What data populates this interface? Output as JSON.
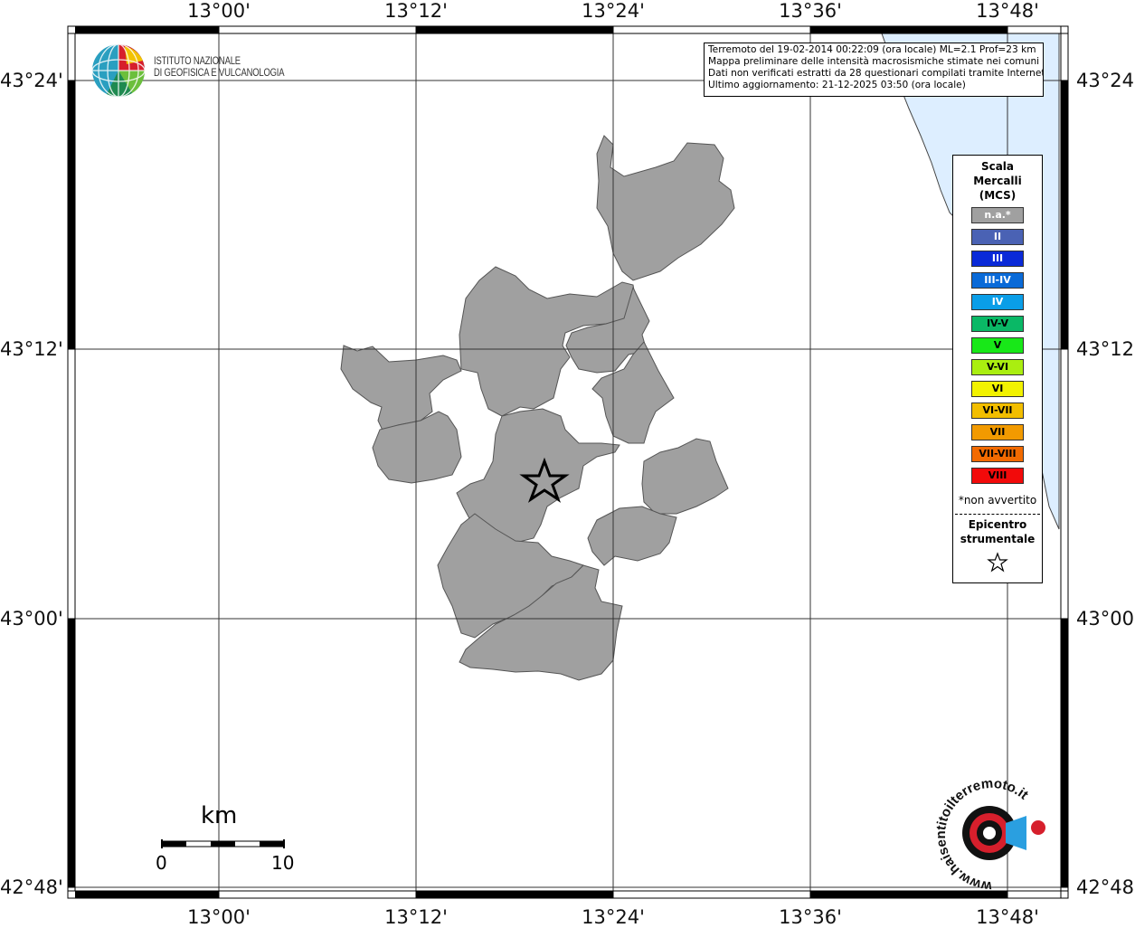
{
  "info": {
    "line1": "Terremoto del 19-02-2014 00:22:09 (ora locale) ML=2.1 Prof=23 km",
    "line2": "Mappa preliminare delle intensità macrosismiche stimate nei comuni",
    "line3": "Dati non verificati estratti da 28 questionari compilati tramite Internet.",
    "line4": "Ultimo aggiornamento: 21-12-2025 03:50 (ora locale)"
  },
  "logo": {
    "line1": "ISTITUTO NAZIONALE",
    "line2": "DI GEOFISICA E VULCANOLOGIA"
  },
  "axes": {
    "lon_ticks": [
      "13°00'",
      "13°12'",
      "13°24'",
      "13°36'",
      "13°48'"
    ],
    "lat_ticks": [
      "43°24'",
      "43°12'",
      "43°00'",
      "42°48'"
    ]
  },
  "legend": {
    "title_line1": "Scala",
    "title_line2": "Mercalli",
    "title_line3": "(MCS)",
    "items": [
      {
        "label": "n.a.*",
        "color": "#a0a0a0",
        "text_color": "#ffffff"
      },
      {
        "label": "II",
        "color": "#4a62b4",
        "text_color": "#ffffff"
      },
      {
        "label": "III",
        "color": "#0a2ad8",
        "text_color": "#ffffff"
      },
      {
        "label": "III-IV",
        "color": "#0a6ad8",
        "text_color": "#ffffff"
      },
      {
        "label": "IV",
        "color": "#0a9ee8",
        "text_color": "#ffffff"
      },
      {
        "label": "IV-V",
        "color": "#0ab866",
        "text_color": "#000000"
      },
      {
        "label": "V",
        "color": "#18e818",
        "text_color": "#000000"
      },
      {
        "label": "V-VI",
        "color": "#aaee10",
        "text_color": "#000000"
      },
      {
        "label": "VI",
        "color": "#f2f200",
        "text_color": "#000000"
      },
      {
        "label": "VI-VII",
        "color": "#f2be00",
        "text_color": "#000000"
      },
      {
        "label": "VII",
        "color": "#f29a00",
        "text_color": "#000000"
      },
      {
        "label": "VII-VIII",
        "color": "#f26a00",
        "text_color": "#000000"
      },
      {
        "label": "VIII",
        "color": "#f20a0a",
        "text_color": "#000000"
      }
    ],
    "note": "*non avvertito",
    "epicenter_line1": "Epicentro",
    "epicenter_line2": "strumentale"
  },
  "scale_bar": {
    "unit": "km",
    "start": "0",
    "end": "10"
  },
  "colors": {
    "municipality_fill": "#a0a0a0",
    "sea": "#ddeeff"
  },
  "watermark": {
    "text": "www.haisentitoilterremoto.it"
  }
}
